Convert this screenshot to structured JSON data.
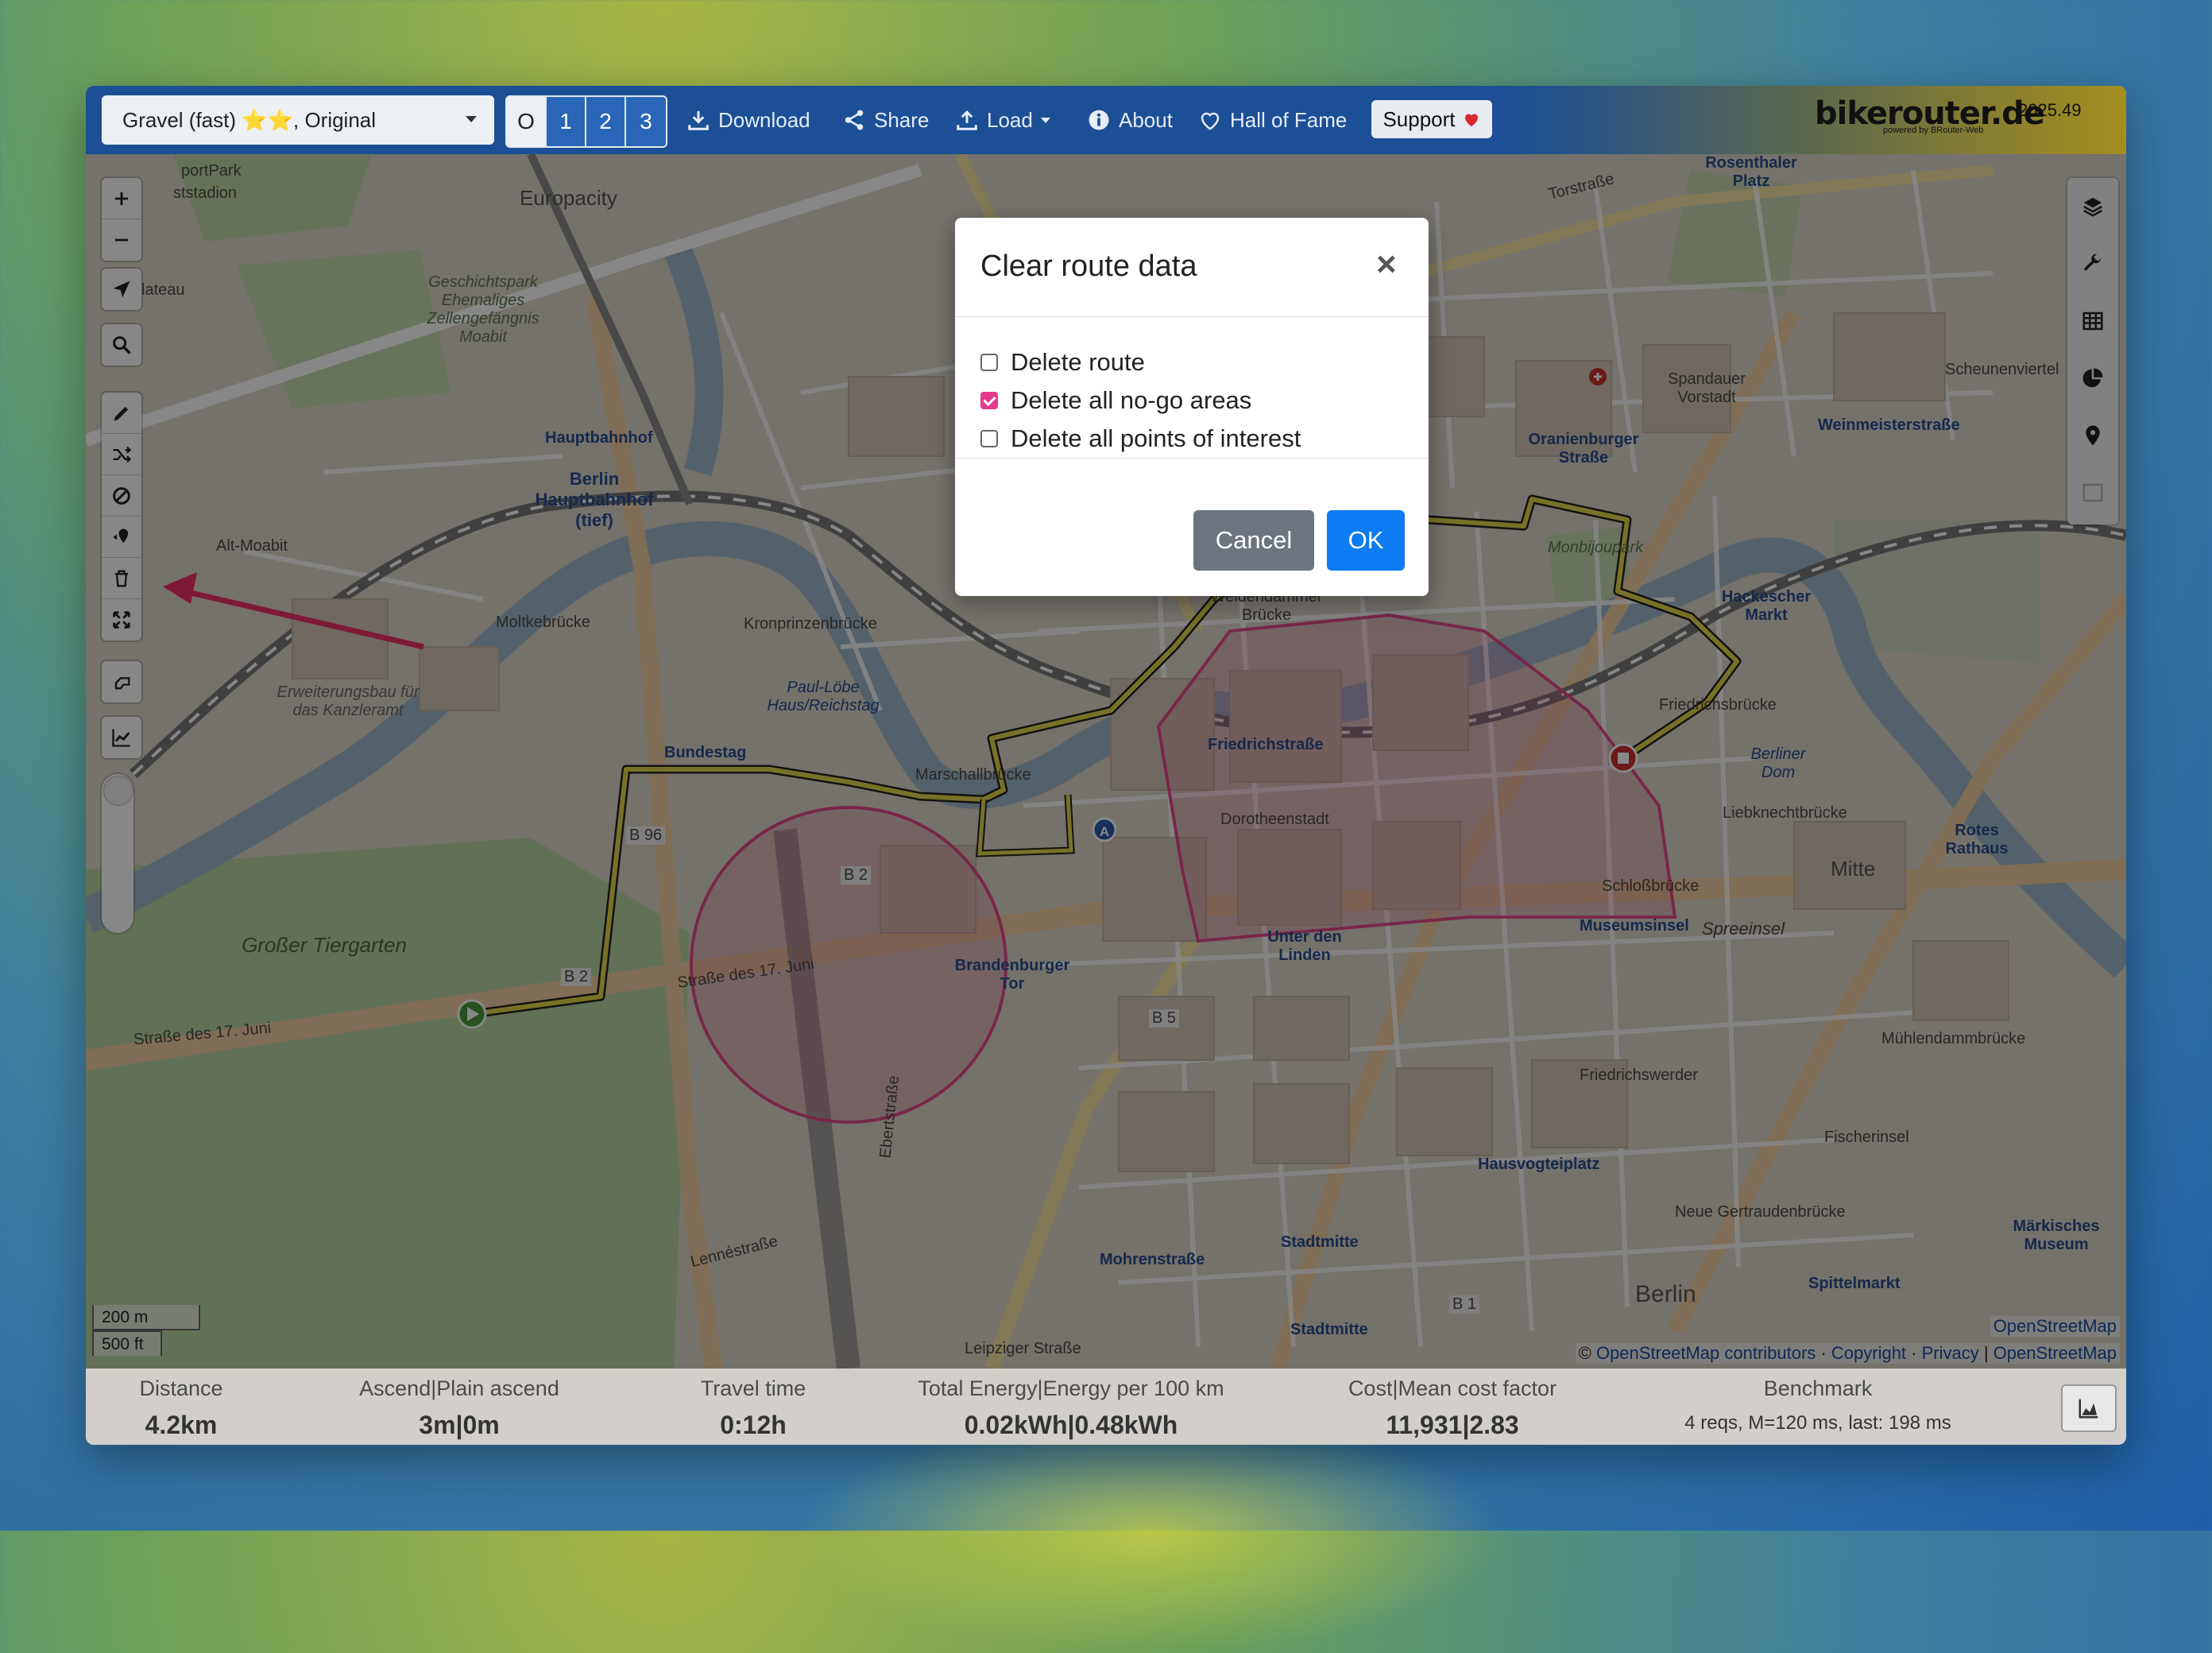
{
  "navbar": {
    "profile_select": "Gravel (fast) ⭐⭐, Original",
    "alternatives": [
      "O",
      "1",
      "2",
      "3"
    ],
    "download_label": "Download",
    "share_label": "Share",
    "load_label": "Load",
    "about_label": "About",
    "hall_of_fame_label": "Hall of Fame",
    "support_label": "Support",
    "brand": "bikerouter.de",
    "brand_sub": "powered by BRouter-Web",
    "version": "2025.49"
  },
  "map": {
    "labels": {
      "sportpark": "portPark",
      "stadion": "ststadion",
      "europacity": "Europacity",
      "geschichtspark": "Geschichtspark Ehemaliges Zellengefängnis Moabit",
      "plateau": "lateau",
      "hauptbahnhof": "Hauptbahnhof",
      "berlin_hbf": "Berlin Hauptbahnhof (tief)",
      "alt_moabit": "Alt-Moabit",
      "moltkebruecke": "Moltkebrücke",
      "kronprinzenbruecke": "Kronprinzenbrücke",
      "paul_loebe": "Paul-Löbe Haus/Reichstag",
      "bundestag": "Bundestag",
      "erweiterungsbau": "Erweiterungsbau für das Kanzleramt",
      "marschallbruecke": "Marschallbrücke",
      "grosser_tiergarten": "Großer Tiergarten",
      "strasse_17_juni": "Straße des 17. Juni",
      "brandenburger_tor": "Brandenburger Tor",
      "weidendammer": "Weidendammer Brücke",
      "friedrichstrasse": "Friedrichstraße",
      "dorotheenstadt": "Dorotheenstadt",
      "unter_den_linden": "Unter den Linden",
      "oranienburger": "Oranienburger Straße",
      "spandauer_vorstadt": "Spandauer Vorstadt",
      "monbijoupark": "Monbijoupark",
      "hackescher_markt": "Hackescher Markt",
      "weinmeister": "Weinmeisterstraße",
      "friedrichsbruecke": "Friedrichsbrücke",
      "berliner_dom": "Berliner Dom",
      "liebknechtbruecke": "Liebknechtbrücke",
      "schlossbruecke": "Schloßbrücke",
      "museumsinsel": "Museumsinsel",
      "spreeinsel": "Spreeinsel",
      "mitte": "Mitte",
      "rotes_rathaus": "Rotes Rathaus",
      "muehlendamm": "Mühlendammbrücke",
      "hausvogteiplatz": "Hausvogteiplatz",
      "friedrichswerder": "Friedrichswerder",
      "fischerinsel": "Fischerinsel",
      "neue_gertrauden": "Neue Gertraudenbrücke",
      "maerkisches_museum": "Märkisches Museum",
      "spittelmarkt": "Spittelmarkt",
      "berlin": "Berlin",
      "stadtmitte": "Stadtmitte",
      "mohrenstrasse": "Mohrenstraße",
      "rosenthaler": "Rosenthaler Platz",
      "torstrasse": "Torstraße",
      "scheunenviertel": "Scheunenviertel",
      "leipziger": "Leipziger Straße",
      "lennestrasse": "Lennéstraße",
      "ebertstrasse": "Ebertstraße",
      "b2": "B 2",
      "b5": "B 5",
      "b1": "B 1",
      "b96": "B 96"
    },
    "scale_m": "200 m",
    "scale_ft": "500 ft",
    "attribution_top": "OpenStreetMap",
    "attribution_osm": "OpenStreetMap contributors",
    "attribution_copyright": "Copyright",
    "attribution_privacy": "Privacy",
    "attribution_osm2": "OpenStreetMap",
    "marker_a": "A"
  },
  "stats": {
    "distance_label": "Distance",
    "distance_value": "4.2km",
    "ascend_label": "Ascend|Plain ascend",
    "ascend_value": "3m|0m",
    "travel_label": "Travel time",
    "travel_value": "0:12h",
    "energy_label": "Total Energy|Energy per 100 km",
    "energy_value": "0.02kWh|0.48kWh",
    "cost_label": "Cost|Mean cost factor",
    "cost_value": "11,931|2.83",
    "benchmark_label": "Benchmark",
    "benchmark_value": "4 reqs, M=120 ms, last: 198 ms"
  },
  "modal": {
    "title": "Clear route data",
    "close": "×",
    "options": [
      {
        "label": "Delete route",
        "checked": false
      },
      {
        "label": "Delete all no-go areas",
        "checked": true
      },
      {
        "label": "Delete all points of interest",
        "checked": false
      }
    ],
    "cancel_label": "Cancel",
    "ok_label": "OK"
  },
  "colors": {
    "navbar": "#1c4f95",
    "route": "#e0d84a",
    "nogo": "#e04a8a",
    "ok": "#0d7bf2",
    "cancel": "#6c757d",
    "arrow": "#f0306a"
  }
}
